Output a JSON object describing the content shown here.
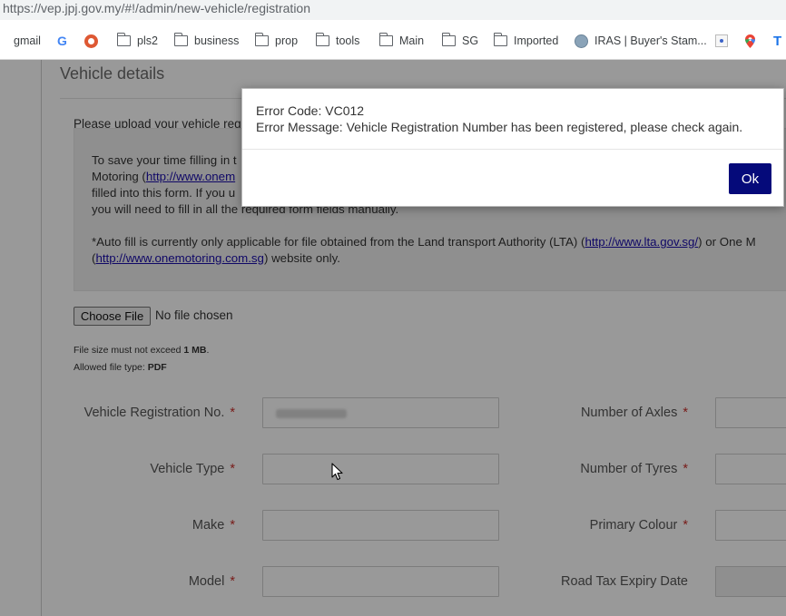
{
  "browser": {
    "url": "https://vep.jpj.gov.my/#!/admin/new-vehicle/registration",
    "bookmarks": [
      {
        "label": "gmail",
        "icon": "folder-icon"
      },
      {
        "label": "",
        "icon": "google-icon"
      },
      {
        "label": "",
        "icon": "duckduckgo-icon"
      },
      {
        "label": "pls2",
        "icon": "folder-icon"
      },
      {
        "label": "business",
        "icon": "folder-icon"
      },
      {
        "label": "prop",
        "icon": "folder-icon"
      },
      {
        "label": "tools",
        "icon": "folder-icon"
      },
      {
        "label": "Main",
        "icon": "folder-icon"
      },
      {
        "label": "SG",
        "icon": "folder-icon"
      },
      {
        "label": "Imported",
        "icon": "folder-icon"
      },
      {
        "label": "IRAS | Buyer's Stam...",
        "icon": "iras-icon"
      },
      {
        "label": "",
        "icon": "extension-icon"
      },
      {
        "label": "",
        "icon": "maps-pin-icon"
      },
      {
        "label": "",
        "icon": "t-icon"
      }
    ]
  },
  "page": {
    "section_title": "Vehicle details",
    "upload_intro": "Please upload your vehicle reg",
    "info": {
      "line1": "To save your time filling in t",
      "line2_prefix": "Motoring (",
      "line2_link": "http://www.onem",
      "line3": "filled into this form. If you u",
      "line4": "you will need to fill in all the required form fields manually.",
      "line5_prefix": "*Auto fill is currently only applicable for file obtained from the Land transport Authority (LTA) (",
      "line5_link": "http://www.lta.gov.sg/",
      "line5_suffix": ") or One M",
      "line6_prefix": "(",
      "line6_link": "http://www.onemotoring.com.sg",
      "line6_suffix": ") website only."
    },
    "file_upload": {
      "button_label": "Choose File",
      "status": "No file chosen",
      "size_note_prefix": "File size must not exceed ",
      "size_note_value": "1 MB",
      "size_note_suffix": ".",
      "type_note_prefix": "Allowed file type: ",
      "type_note_value": "PDF"
    },
    "fields_left": [
      {
        "label": "Vehicle Registration No.",
        "required": "*"
      },
      {
        "label": "Vehicle Type",
        "required": "*"
      },
      {
        "label": "Make",
        "required": "*"
      },
      {
        "label": "Model",
        "required": "*"
      }
    ],
    "fields_right": [
      {
        "label": "Number of Axles",
        "required": "*"
      },
      {
        "label": "Number of Tyres",
        "required": "*"
      },
      {
        "label": "Primary Colour",
        "required": "*"
      },
      {
        "label": "Road Tax Expiry Date",
        "required": ""
      }
    ]
  },
  "modal": {
    "error_code": "Error Code: VC012",
    "error_message": "Error Message: Vehicle Registration Number has been registered, please check again.",
    "ok_label": "Ok"
  },
  "colors": {
    "ok_button": "#050a7a",
    "required_asterisk": "#c9302c",
    "link": "#1a0dab"
  }
}
